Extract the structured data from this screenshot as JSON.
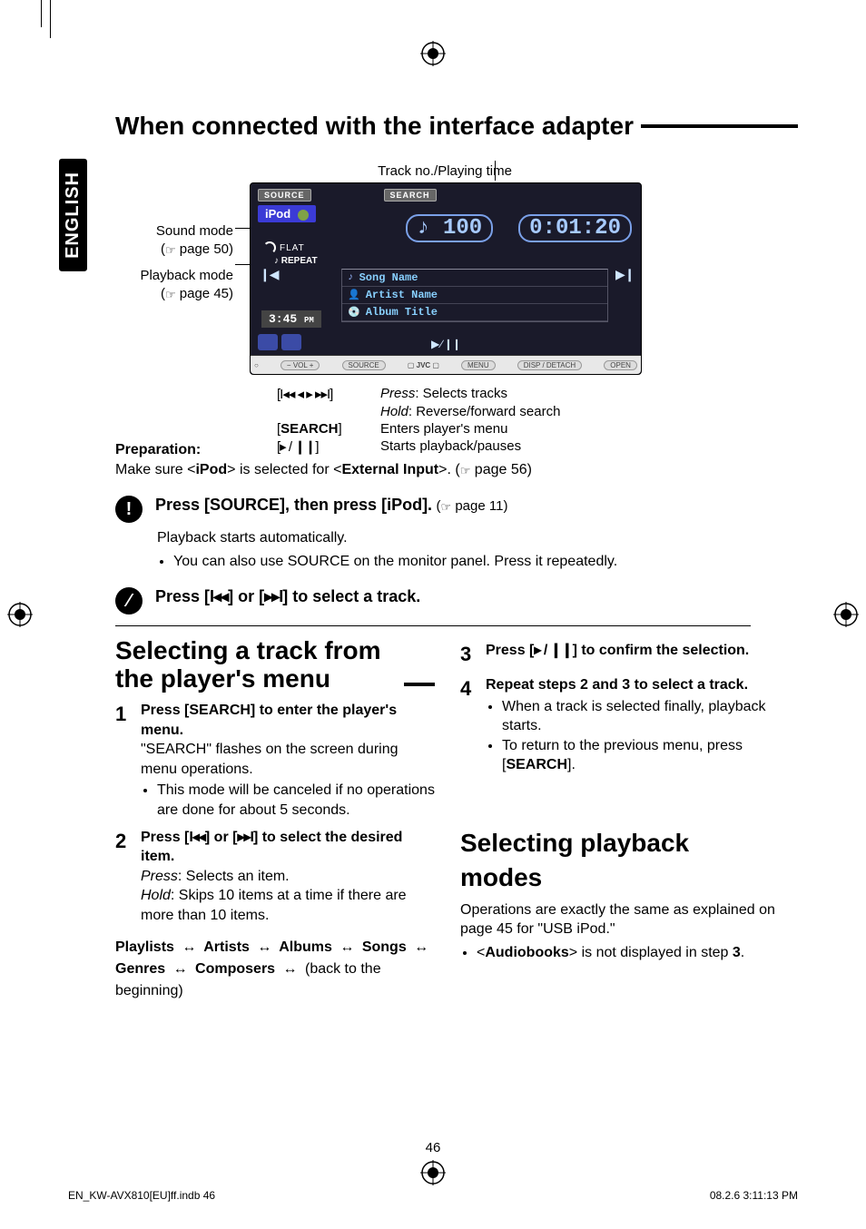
{
  "side_tab": "ENGLISH",
  "h1_main": "When connected with the interface adapter",
  "tracklabel": "Track no./Playing time",
  "left_labels": {
    "sound_mode": "Sound mode",
    "sound_mode_ref": " page 50)",
    "playback_mode": "Playback mode",
    "playback_mode_ref": " page 45)"
  },
  "screen": {
    "btn_source": "SOURCE",
    "btn_search": "SEARCH",
    "source_value": "iPod",
    "track_no": "100",
    "playtime": "0:01:20",
    "flat": "FLAT",
    "repeat": "REPEAT",
    "song": "Song Name",
    "artist": "Artist Name",
    "album": "Album Title",
    "clock": "3:45",
    "ampm": "PM",
    "brand": "JVC",
    "hb": {
      "vol": "VOL",
      "src": "SOURCE",
      "menu": "MENU",
      "disp": "DISP",
      "detach": "DETACH",
      "open": "OPEN"
    }
  },
  "controls": {
    "track_key": "[I◂◂ ◂ ▸ ▸▸I]",
    "track_press_lbl": "Press",
    "track_press": ": Selects tracks",
    "track_hold_lbl": "Hold",
    "track_hold": ": Reverse/forward search",
    "search_key": "[SEARCH]",
    "search_val": "Enters player's menu",
    "play_key": "[▸ / ❙❙]",
    "play_val": "Starts playback/pauses"
  },
  "prep": {
    "title": "Preparation:",
    "line_a": "Make sure <",
    "ipod": "iPod",
    "line_b": "> is selected for <",
    "extin": "External Input",
    "line_c": ">. (",
    "ref": " page 56)"
  },
  "step1": {
    "lead": "Press [SOURCE], then press [iPod].",
    "sub": "(",
    "ref": " page 11)",
    "auto": "Playback starts automatically.",
    "bullet": "You can also use SOURCE on the monitor panel. Press it repeatedly."
  },
  "step2": {
    "lead_a": "Press [",
    "lead_b": "] or [",
    "lead_c": "] to select a track.",
    "k1": "I◂◂",
    "k2": "▸▸I"
  },
  "leftcol": {
    "h2": "Selecting a track from the player's menu",
    "s1": {
      "lead": "Press [SEARCH] to enter the player's menu.",
      "body": "\"SEARCH\" flashes on the screen during menu operations.",
      "bullet": "This mode will be canceled if no operations are done for about 5 seconds."
    },
    "s2": {
      "lead_a": "Press [",
      "lead_b": "] or [",
      "lead_c": "] to select the desired item.",
      "k1": "I◂◂",
      "k2": "▸▸I",
      "press_lbl": "Press",
      "press": ":   Selects an item.",
      "hold_lbl": "Hold",
      "hold": ":   Skips 10 items at a time if there are more than 10 items."
    },
    "path": {
      "items": [
        "Playlists",
        "Artists",
        "Albums",
        "Songs",
        "Genres",
        "Composers"
      ],
      "tail": " (back to the beginning)"
    }
  },
  "rightcol": {
    "s3": {
      "lead_a": "Press [",
      "key": "▸ / ❙❙",
      "lead_b": "] to confirm the selection."
    },
    "s4": {
      "lead": "Repeat steps 2 and 3 to select a track.",
      "b1": "When a track is selected finally, playback starts.",
      "b2a": "To return to the previous menu, press [",
      "b2k": "SEARCH",
      "b2b": "]."
    },
    "h2": "Selecting playback modes",
    "p1": "Operations are exactly the same as explained on page 45 for \"USB iPod.\"",
    "b1a": "<",
    "b1k": "Audiobooks",
    "b1b": "> is not displayed in step ",
    "b1n": "3",
    "b1c": "."
  },
  "page_num": "46",
  "footer_left": "EN_KW-AVX810[EU]ff.indb   46",
  "footer_right": "08.2.6   3:11:13 PM"
}
